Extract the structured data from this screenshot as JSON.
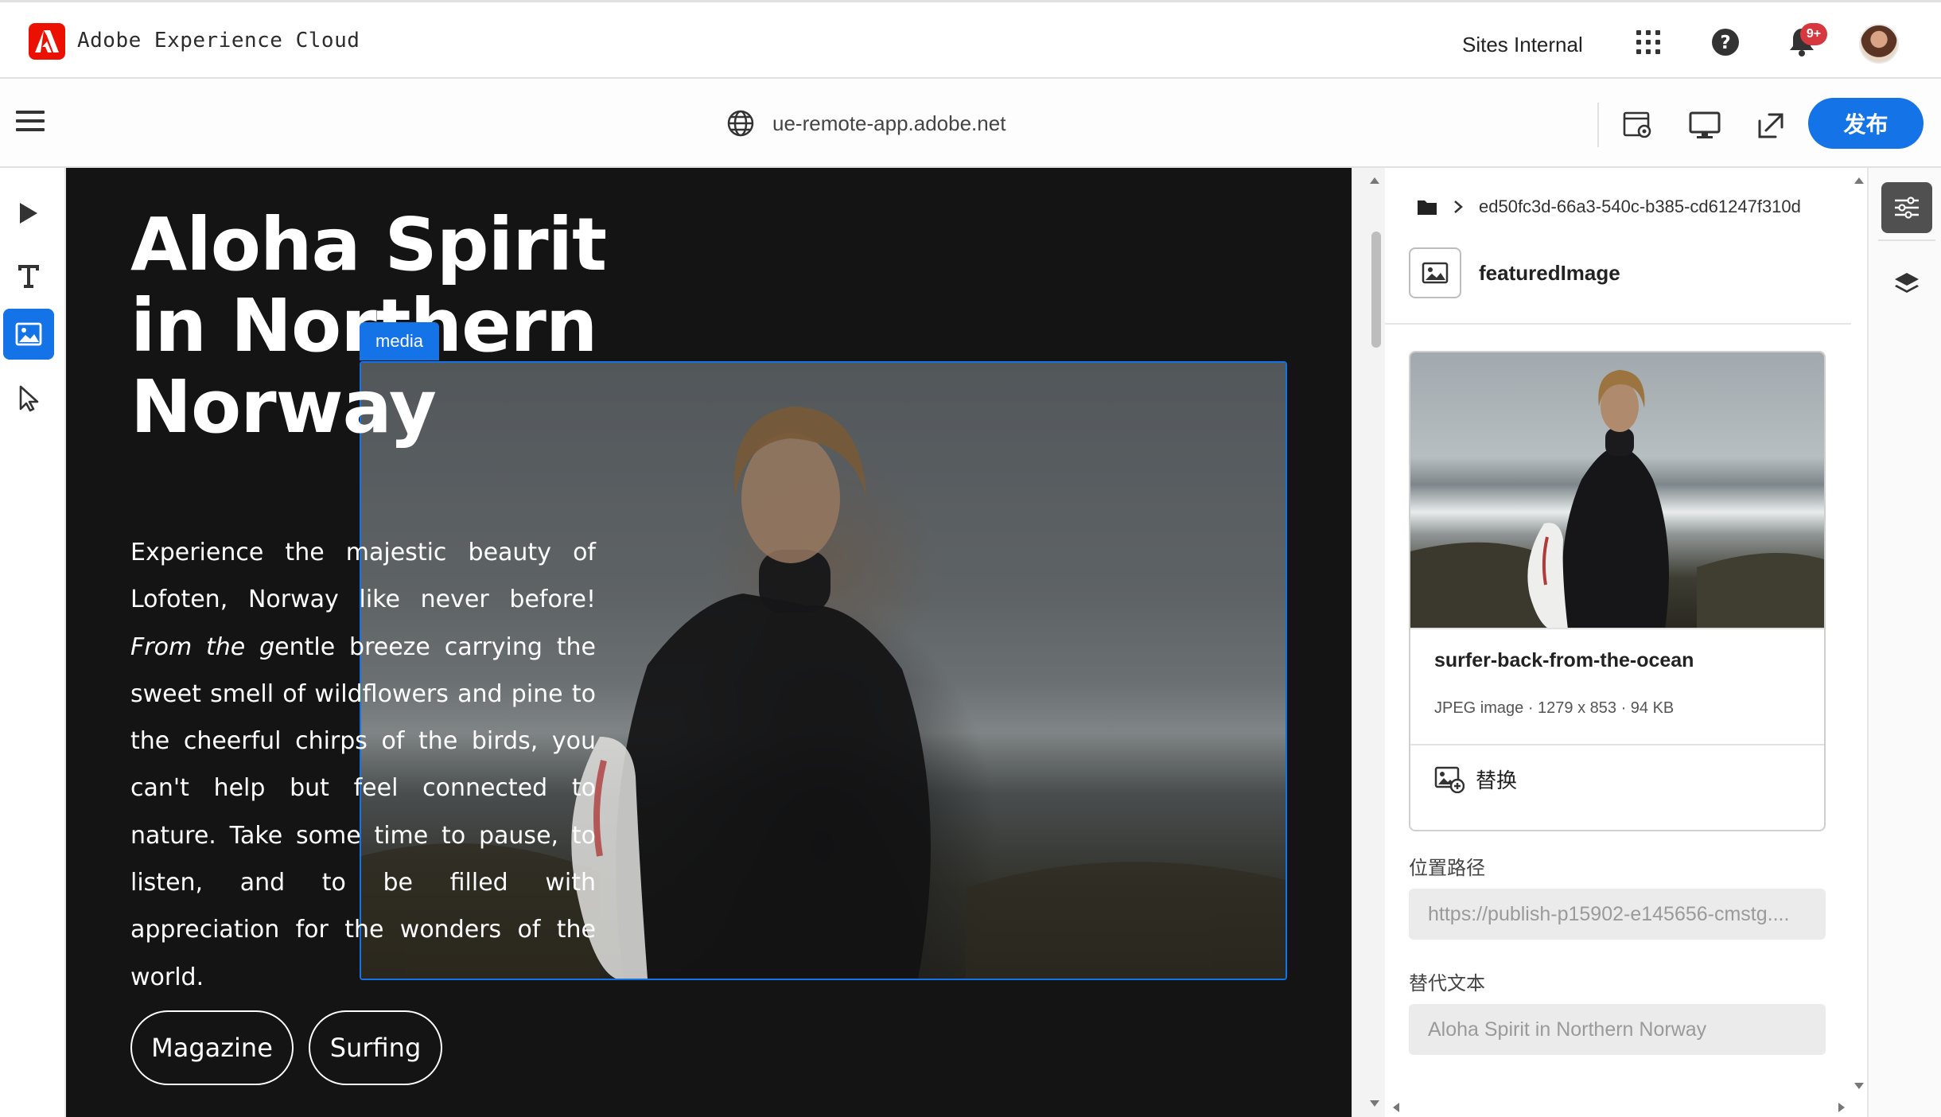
{
  "shell": {
    "app_title": "Adobe Experience Cloud",
    "org_name": "Sites Internal",
    "notification_badge": "9+",
    "icons": [
      "adobe-logo",
      "apps-grid-icon",
      "help-icon",
      "bell-icon",
      "avatar"
    ]
  },
  "editor_toolbar": {
    "url": "ue-remote-app.adobe.net",
    "publish_label": "发布",
    "icons": [
      "menu-icon",
      "globe-icon",
      "page-settings-icon",
      "desktop-preview-icon",
      "open-external-icon"
    ]
  },
  "left_rail": {
    "tools": [
      {
        "name": "preview",
        "icon": "play-icon"
      },
      {
        "name": "text",
        "icon": "text-icon"
      },
      {
        "name": "media",
        "icon": "image-icon",
        "active": true
      },
      {
        "name": "select",
        "icon": "pointer-icon"
      }
    ]
  },
  "canvas": {
    "hero_title_lines": [
      "Aloha Spirit",
      "in Northern",
      "Norway"
    ],
    "body_parts": [
      {
        "text": "Experience the majestic beauty of Lofoten, Norway like never before! ",
        "italic": false
      },
      {
        "text": "From the g",
        "italic": true
      },
      {
        "text": "entle breeze carrying the sweet smell of wildflowers and pine to the cheerful chirps of the birds, you can't help but feel connected to nature. Take some time to pause, to listen, and to be filled with appreciation for the wonders of the world.",
        "italic": false
      }
    ],
    "media_label": "media",
    "tags": [
      "Magazine",
      "Surfing"
    ]
  },
  "properties": {
    "breadcrumb_id": "ed50fc3d-66a3-540c-b385-cd61247f310d",
    "component_name": "featuredImage",
    "asset": {
      "title": "surfer-back-from-the-ocean",
      "meta": "JPEG image · 1279 x 853 · 94 KB",
      "replace_label": "替换"
    },
    "fields": [
      {
        "label": "位置路径",
        "value": "https://publish-p15902-e145656-cmstg...."
      },
      {
        "label": "替代文本",
        "value": "Aloha Spirit in Northern Norway"
      }
    ]
  },
  "right_rail": {
    "tabs": [
      {
        "name": "properties",
        "icon": "sliders-icon",
        "active": true
      },
      {
        "name": "layers",
        "icon": "layers-icon"
      }
    ]
  },
  "colors": {
    "accent": "#1473e6",
    "canvas_bg": "#141414",
    "adobe_red": "#eb1000",
    "badge_red": "#d7373f"
  }
}
